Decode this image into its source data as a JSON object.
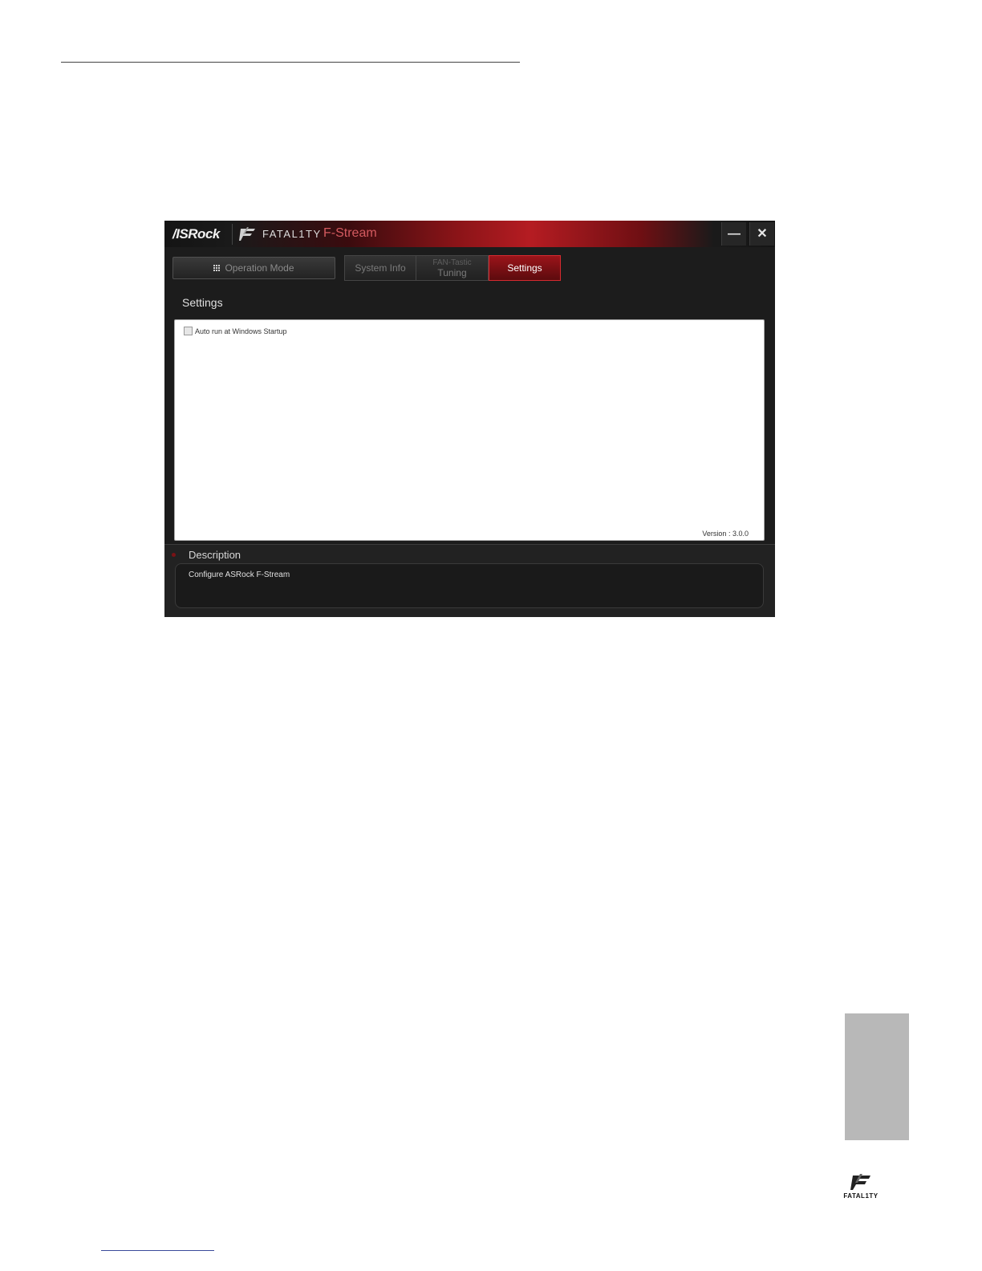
{
  "window": {
    "brand": "/ISRock",
    "fatality_wordmark": "FATAL1TY",
    "title": "F-Stream",
    "minimize_label": "—",
    "close_label": "✕"
  },
  "nav": {
    "operation_mode": "Operation Mode",
    "tabs": [
      {
        "label": "System Info"
      },
      {
        "label_line1": "FAN-Tastic",
        "label_line2": "Tuning"
      },
      {
        "label": "Settings",
        "active": true
      }
    ]
  },
  "settings": {
    "heading": "Settings",
    "auto_run_label": "Auto run at Windows Startup",
    "auto_run_checked": false,
    "version_label": "Version",
    "version_separator": ":",
    "version_value": "3.0.0"
  },
  "description": {
    "heading": "Description",
    "text": "Configure ASRock F-Stream"
  },
  "footer": {
    "logo_word": "FATAL1TY"
  },
  "colors": {
    "accent_red": "#b51c22",
    "window_bg": "#1c1c1c",
    "side_tab_gray": "#b8b8b8"
  }
}
